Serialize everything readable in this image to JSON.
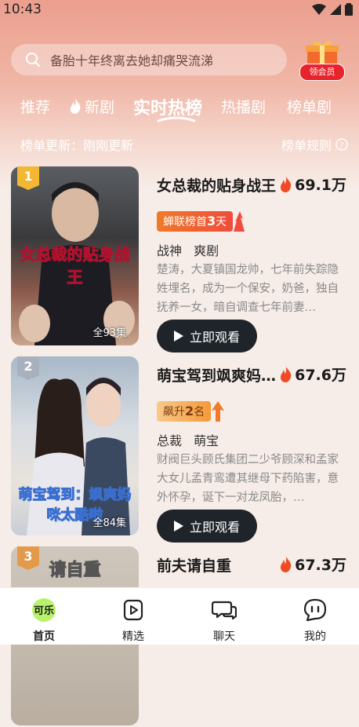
{
  "status": {
    "time": "10:43"
  },
  "search": {
    "placeholder": "备胎十年终离去她却痛哭流涕"
  },
  "member": {
    "label": "领会员"
  },
  "tabs": [
    {
      "label": "推荐"
    },
    {
      "label": "新剧"
    },
    {
      "label": "实时热榜"
    },
    {
      "label": "热播剧"
    },
    {
      "label": "榜单剧"
    }
  ],
  "update_text": "榜单更新：刚刚更新",
  "rules_label": "榜单规则",
  "items": [
    {
      "rank": "1",
      "poster_title": "女总裁的贴身战王",
      "episodes": "全93集",
      "title": "女总裁的贴身战王",
      "heat": "69.1万",
      "tag_prefix": "蝉联榜首",
      "tag_num": "3",
      "tag_suffix": "天",
      "genres": [
        "战神",
        "爽剧"
      ],
      "desc": "楚涛，大夏镇国龙帅，七年前失踪隐姓埋名，成为一个保安，奶爸，独自抚养一女，暗自调查七年前妻…",
      "watch_label": "立即观看"
    },
    {
      "rank": "2",
      "poster_title": "萌宝驾到：飒爽妈咪太酷啦",
      "episodes": "全84集",
      "title": "萌宝驾到飒爽妈…",
      "heat": "67.6万",
      "tag_prefix": "飙升",
      "tag_num": "2",
      "tag_suffix": "名",
      "genres": [
        "总裁",
        "萌宝"
      ],
      "desc": "财阀巨头顾氏集团二少爷顾深和孟家大女儿孟青鸾遭其继母下药陷害，意外怀孕，诞下一对龙凤胎，…",
      "watch_label": "立即观看"
    },
    {
      "rank": "3",
      "poster_title": "请自重",
      "title": "前夫请自重",
      "heat": "67.3万"
    }
  ],
  "nav": [
    {
      "label": "首页"
    },
    {
      "label": "精选"
    },
    {
      "label": "聊天"
    },
    {
      "label": "我的"
    }
  ],
  "colors": {
    "accent": "#e8232b",
    "dark_button": "#1f242b",
    "fire": "#f04a24"
  }
}
